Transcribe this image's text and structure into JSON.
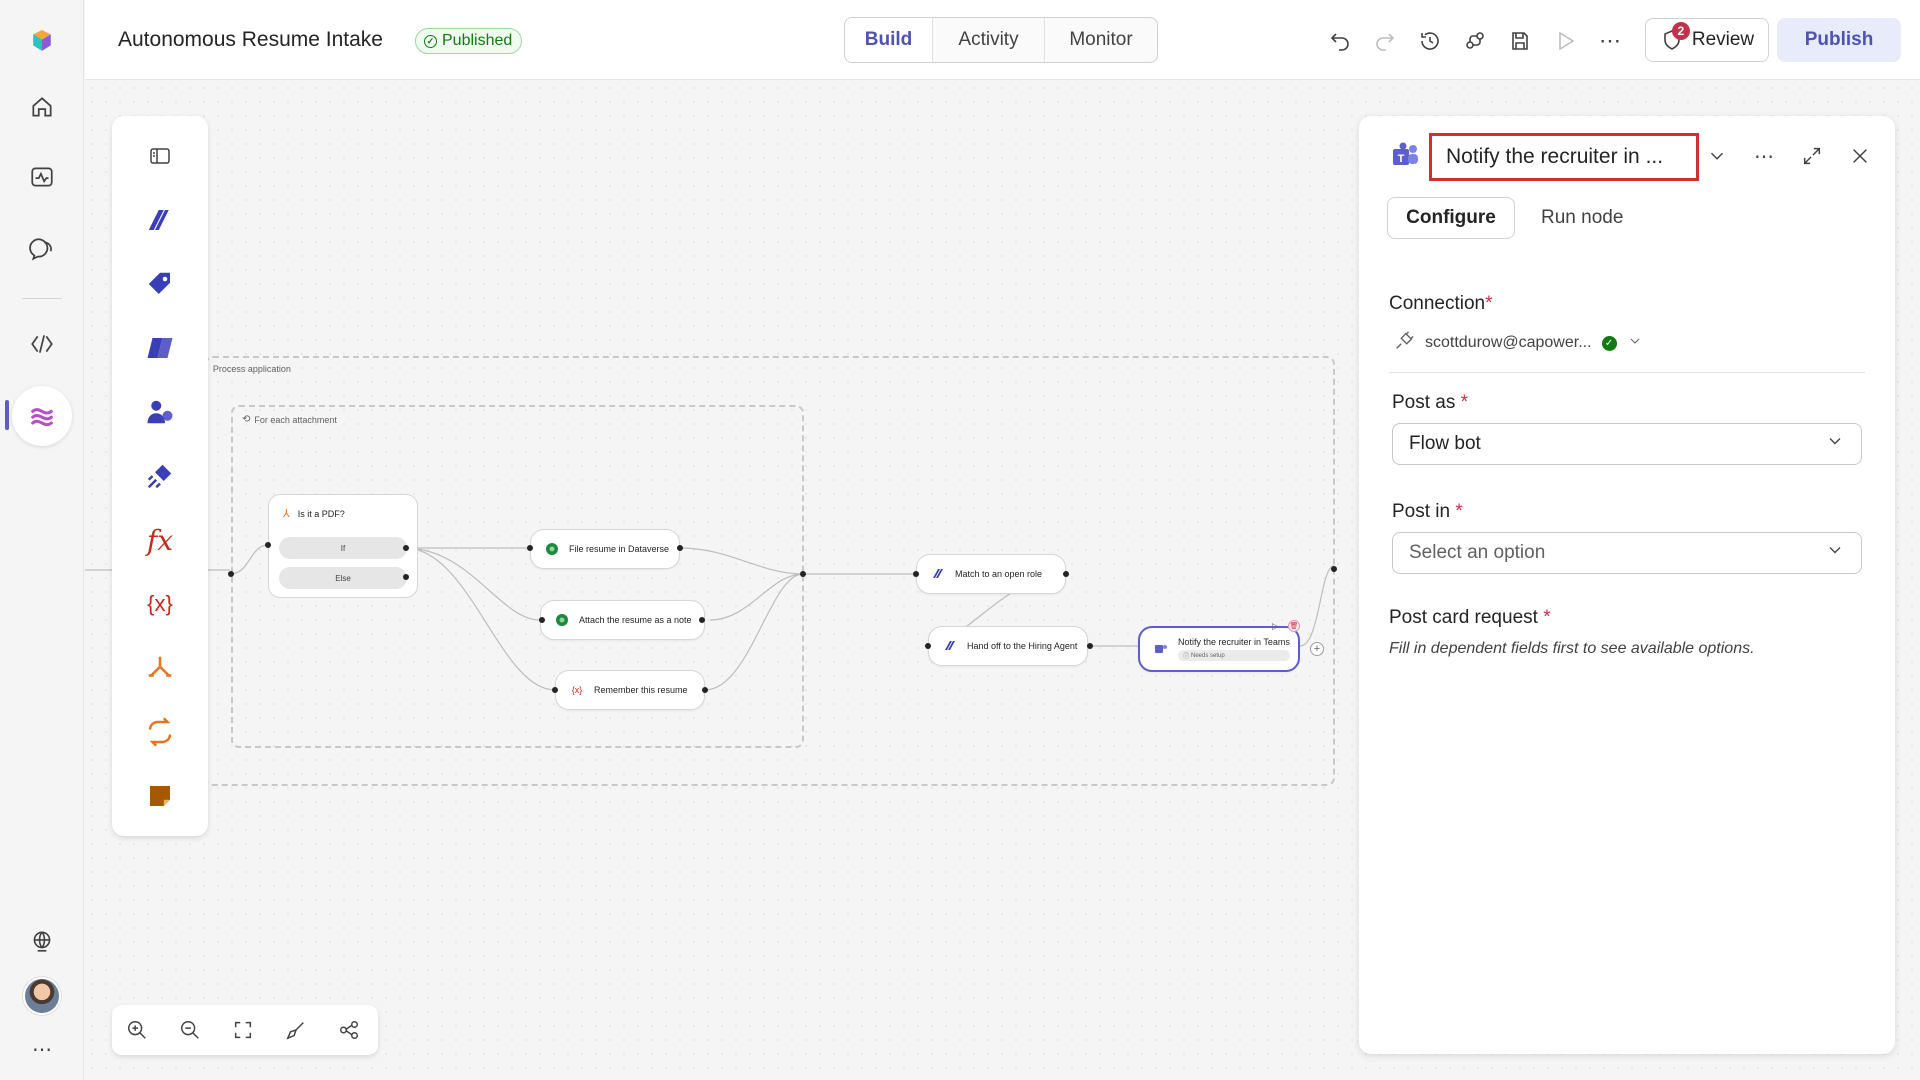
{
  "app": {
    "title": "Autonomous Resume Intake",
    "status": "Published"
  },
  "nav": {
    "tabs": [
      {
        "label": "Build",
        "active": true
      },
      {
        "label": "Activity",
        "active": false
      },
      {
        "label": "Monitor",
        "active": false
      }
    ]
  },
  "toolbar": {
    "review_label": "Review",
    "review_count": "2",
    "publish_label": "Publish",
    "icons": [
      "undo-icon",
      "redo-icon",
      "history-icon",
      "flow-checker-icon",
      "save-icon",
      "run-icon",
      "more-icon"
    ]
  },
  "rail": {
    "icons": [
      "app-logo-icon",
      "home-icon",
      "activity-icon",
      "chat-icon",
      "code-agent-icon",
      "flows-icon",
      "globe-icon",
      "avatar",
      "more-icon"
    ]
  },
  "palette": {
    "icons": [
      "toggle-panel-icon",
      "copilot-studio-icon",
      "tag-icon",
      "copilot-icon",
      "people-icon",
      "connector-icon",
      "function-icon",
      "variable-icon",
      "condition-icon",
      "loop-icon",
      "note-icon"
    ]
  },
  "canvas": {
    "outer_group": "Process application",
    "inner_group": "For each attachment",
    "condition": {
      "title": "Is it a PDF?",
      "options": [
        "If",
        "Else"
      ]
    },
    "nodes": {
      "file_resume": "File resume in Dataverse",
      "attach_note": "Attach the resume as a note",
      "remember": "Remember this resume",
      "match_role": "Match to an open role",
      "hand_off": "Hand off to the Hiring Agent",
      "notify": "Notify the recruiter in Teams",
      "notify_status": "Needs setup"
    }
  },
  "panel": {
    "title": "Notify the recruiter in ...",
    "tabs": {
      "configure": "Configure",
      "run": "Run node"
    },
    "connection_label": "Connection",
    "connection_value": "scottdurow@capower...",
    "post_as_label": "Post as",
    "post_as_value": "Flow bot",
    "post_in_label": "Post in",
    "post_in_placeholder": "Select an option",
    "post_card_label": "Post card request",
    "post_card_hint": "Fill in dependent fields first to see available options.",
    "required_mark": "*"
  },
  "colors": {
    "accent": "#5b5fc7",
    "published_green": "#107c10",
    "highlight_red": "#d32f2f",
    "orange": "#e8741e",
    "red_fx": "#c42b1c"
  }
}
